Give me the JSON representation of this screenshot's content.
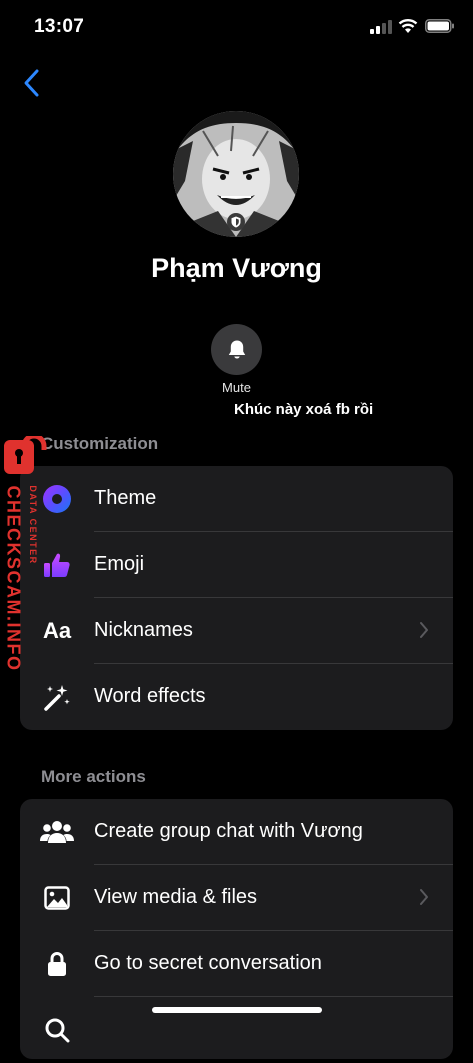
{
  "status_bar": {
    "time": "13:07"
  },
  "profile": {
    "name": "Phạm Vương"
  },
  "actions": {
    "mute_label": "Mute"
  },
  "overlay_note": "Khúc này xoá fb rồi",
  "customization": {
    "title": "Customization",
    "items": [
      {
        "label": "Theme",
        "icon": "theme-icon",
        "chevron": false
      },
      {
        "label": "Emoji",
        "icon": "thumbs-up-icon",
        "chevron": false
      },
      {
        "label": "Nicknames",
        "icon": "aa-icon",
        "icon_text": "Aa",
        "chevron": true
      },
      {
        "label": "Word effects",
        "icon": "sparkle-wand-icon",
        "chevron": false
      }
    ]
  },
  "more_actions": {
    "title": "More actions",
    "items": [
      {
        "label": "Create group chat with Vương",
        "icon": "group-icon",
        "chevron": false
      },
      {
        "label": "View media & files",
        "icon": "image-icon",
        "chevron": true
      },
      {
        "label": "Go to secret conversation",
        "icon": "lock-icon",
        "chevron": false
      }
    ]
  },
  "watermark": {
    "brand": "CHECKSCAM.INFO",
    "sub": "DATA CENTER"
  },
  "colors": {
    "accent_blue": "#2d88ff",
    "watermark_red": "#e0322e",
    "card_bg": "#1c1c1e"
  }
}
